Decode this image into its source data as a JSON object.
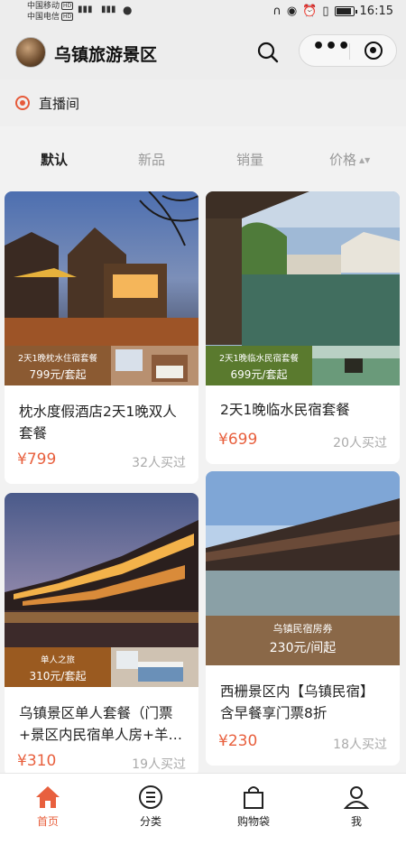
{
  "status_bar": {
    "carrier1": "中国移动",
    "carrier2": "中国电信",
    "hd": "HD",
    "net": "4G",
    "time": "16:15"
  },
  "header": {
    "title": "乌镇旅游景区",
    "icons": [
      "search-icon",
      "more-icon",
      "target-icon"
    ]
  },
  "live": {
    "label": "直播间"
  },
  "sort_tabs": [
    {
      "label": "默认",
      "active": true
    },
    {
      "label": "新品"
    },
    {
      "label": "销量"
    },
    {
      "label": "价格"
    }
  ],
  "products": [
    {
      "title_line1": "枕水度假酒店2天1晚双人",
      "title_line2": "套餐",
      "price": "¥799",
      "sold": "32人买过",
      "banner_line1": "2天1晚枕水住宿套餐",
      "banner_line2": "799元/套起"
    },
    {
      "title_line1": "2天1晚临水民宿套餐",
      "price": "¥699",
      "sold": "20人买过",
      "banner_line1": "2天1晚临水民宿套餐",
      "banner_line2": "699元/套起"
    },
    {
      "title_line1": "乌镇景区单人套餐（门票",
      "title_line2": "+景区内民宿单人房+羊…",
      "price": "¥310",
      "sold": "19人买过",
      "banner_line1": "单人之旅",
      "banner_line2": "310元/套起"
    },
    {
      "title_line1": "西栅景区内【乌镇民宿】",
      "title_line2": "含早餐享门票8折",
      "price": "¥230",
      "sold": "18人买过",
      "banner_line1": "乌镇民宿房券",
      "banner_line2": "230元/间起"
    }
  ],
  "bottom_nav": [
    {
      "label": "首页",
      "icon": "home-icon",
      "active": true
    },
    {
      "label": "分类",
      "icon": "category-icon"
    },
    {
      "label": "购物袋",
      "icon": "bag-icon"
    },
    {
      "label": "我",
      "icon": "user-icon"
    }
  ],
  "colors": {
    "accent": "#e8603e",
    "banner_brown": "#8b5a32"
  }
}
